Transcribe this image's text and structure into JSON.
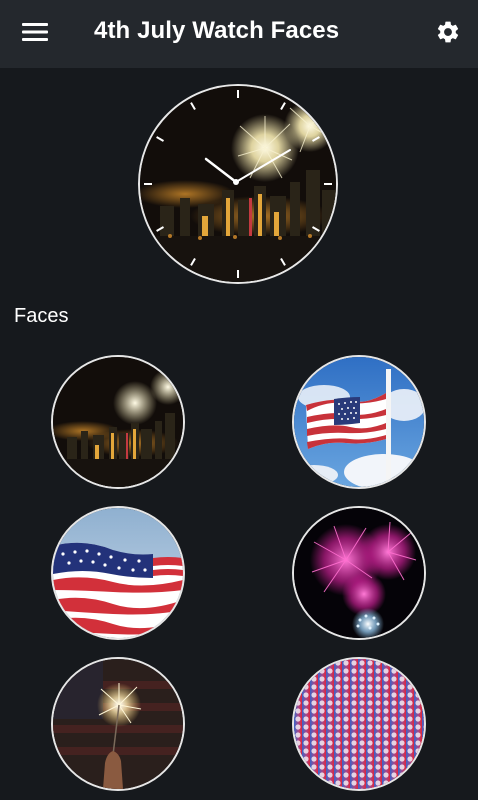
{
  "appbar": {
    "title": "4th July Watch Faces",
    "menu_icon": "hamburger-menu-icon",
    "settings_icon": "gear-icon"
  },
  "preview": {
    "theme": "city-skyline-fireworks",
    "hands": "analog"
  },
  "faces_section": {
    "label": "Faces",
    "items": [
      {
        "name": "city-fireworks"
      },
      {
        "name": "flag-on-pole"
      },
      {
        "name": "waving-flag"
      },
      {
        "name": "pink-fireworks"
      },
      {
        "name": "sparkler"
      },
      {
        "name": "halftone-red-blue"
      }
    ]
  },
  "colors": {
    "appbar": "#24282d",
    "background": "#16191d",
    "ring": "#e8e8e8"
  }
}
